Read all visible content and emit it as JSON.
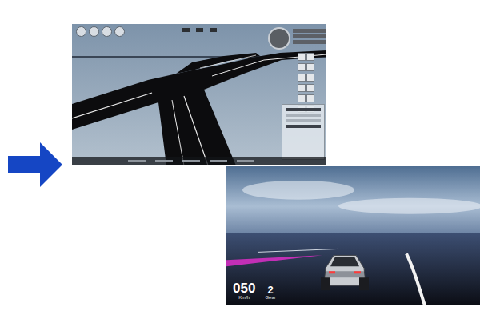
{
  "driving_view": {
    "hud": {
      "speed": "050",
      "speed_unit": "Km/h",
      "gear": "2",
      "gear_label": "Gear"
    }
  }
}
